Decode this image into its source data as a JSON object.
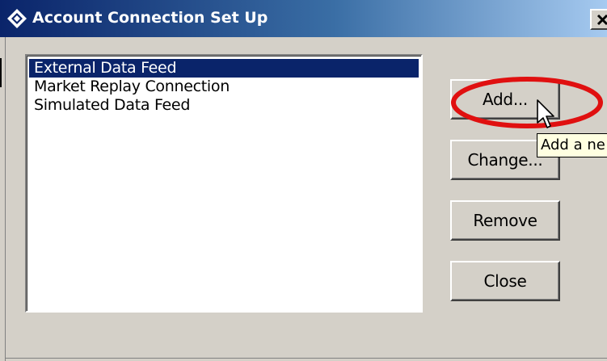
{
  "window": {
    "title": "Account Connection Set Up",
    "close_glyph": "✕"
  },
  "connections": {
    "items": [
      {
        "label": "External Data Feed",
        "selected": true
      },
      {
        "label": "Market Replay Connection",
        "selected": false
      },
      {
        "label": "Simulated Data Feed",
        "selected": false
      }
    ]
  },
  "buttons": {
    "add_label": "Add...",
    "change_label": "Change...",
    "remove_label": "Remove",
    "close_label": "Close"
  },
  "tooltip": {
    "text": "Add a ne"
  },
  "colors": {
    "titlebar_start": "#0a246a",
    "titlebar_end": "#a6caf0",
    "selection": "#0a246a",
    "annotation": "#e01010",
    "tooltip_bg": "#ffffe1",
    "dialog_bg": "#d4d0c8"
  },
  "icons": {
    "title": "diamond-app-icon",
    "close": "close-icon",
    "cursor": "mouse-pointer-icon"
  }
}
